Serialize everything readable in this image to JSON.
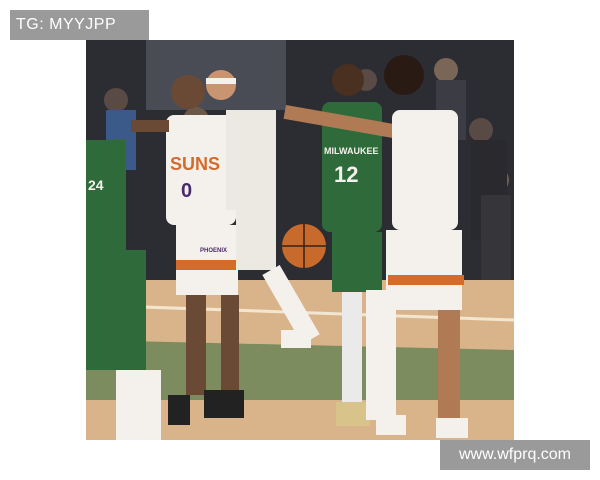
{
  "watermarks": {
    "top_left": "TG: MYYJPP",
    "bottom_right": "www.wfprq.com"
  },
  "photo": {
    "jersey_texts": {
      "suns_front": "SUNS",
      "suns_number": "0",
      "bucks_front": "MILWAUKEE",
      "bucks_number": "12",
      "suns_shorts": "PHOENIX",
      "bucks_partial": "24"
    },
    "colors": {
      "court_wood": "#d9b48a",
      "bucks_green": "#2f6b3a",
      "suns_white": "#f4f1ec",
      "suns_purple": "#4b2a6b",
      "suns_orange": "#d56b2a",
      "crowd_dark": "#2c2c33"
    }
  }
}
